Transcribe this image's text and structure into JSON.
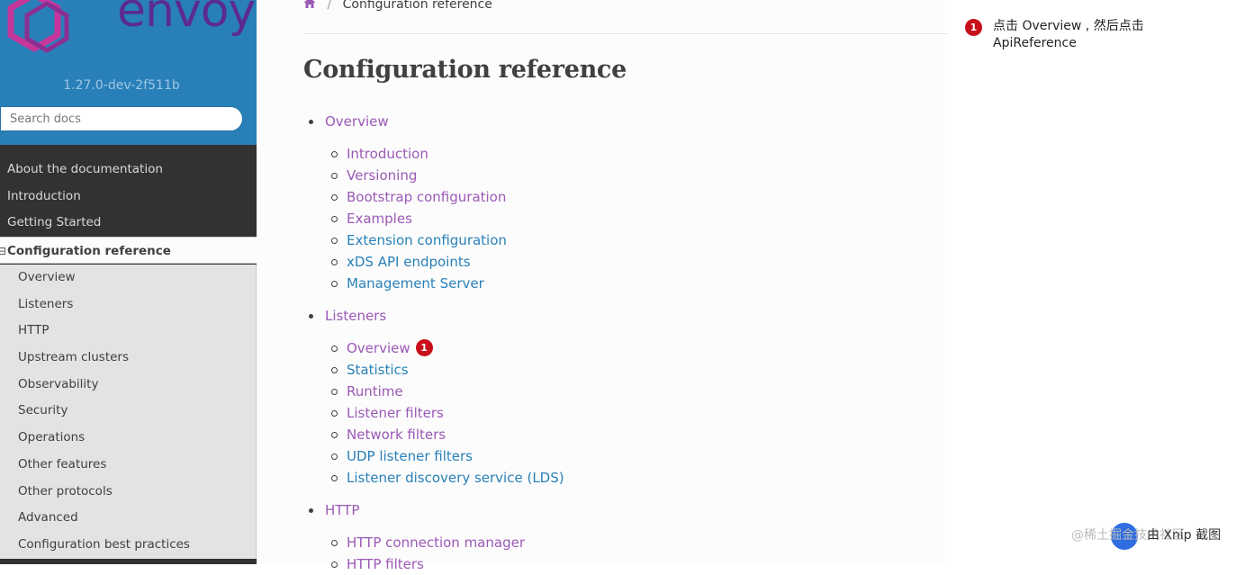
{
  "sidebar": {
    "brand": "envoy",
    "version": "1.27.0-dev-2f511b",
    "search_placeholder": "Search docs",
    "top_items": [
      "About the documentation",
      "Introduction",
      "Getting Started"
    ],
    "current": {
      "expander": "⊟",
      "label": "Configuration reference"
    },
    "sub_items": [
      "Overview",
      "Listeners",
      "HTTP",
      "Upstream clusters",
      "Observability",
      "Security",
      "Operations",
      "Other features",
      "Other protocols",
      "Advanced",
      "Configuration best practices"
    ]
  },
  "breadcrumb": {
    "current": "Configuration reference"
  },
  "page_title": "Configuration reference",
  "toc": {
    "sections": [
      {
        "label": "Overview",
        "items": [
          {
            "label": "Introduction",
            "visited": true
          },
          {
            "label": "Versioning",
            "visited": true
          },
          {
            "label": "Bootstrap configuration",
            "visited": true
          },
          {
            "label": "Examples",
            "visited": true
          },
          {
            "label": "Extension configuration",
            "visited": false
          },
          {
            "label": "xDS API endpoints",
            "visited": false
          },
          {
            "label": "Management Server",
            "visited": false
          }
        ]
      },
      {
        "label": "Listeners",
        "items": [
          {
            "label": "Overview",
            "visited": true,
            "badge": "1"
          },
          {
            "label": "Statistics",
            "visited": false
          },
          {
            "label": "Runtime",
            "visited": true
          },
          {
            "label": "Listener filters",
            "visited": true
          },
          {
            "label": "Network filters",
            "visited": true
          },
          {
            "label": "UDP listener filters",
            "visited": false
          },
          {
            "label": "Listener discovery service (LDS)",
            "visited": false
          }
        ]
      },
      {
        "label": "HTTP",
        "items": [
          {
            "label": "HTTP connection manager",
            "visited": true
          },
          {
            "label": "HTTP filters",
            "visited": true
          }
        ]
      }
    ]
  },
  "annotation": {
    "badge": "1",
    "text": "点击 Overview , 然后点击 ApiReference"
  },
  "watermark": {
    "left": "@稀土掘金技术社区",
    "right": "由 Xnip 截图"
  },
  "colors": {
    "visited": "#9b59b6",
    "link": "#2980b9",
    "sidebar": "#343131",
    "header": "#2980b9",
    "badge": "#c8101a"
  }
}
